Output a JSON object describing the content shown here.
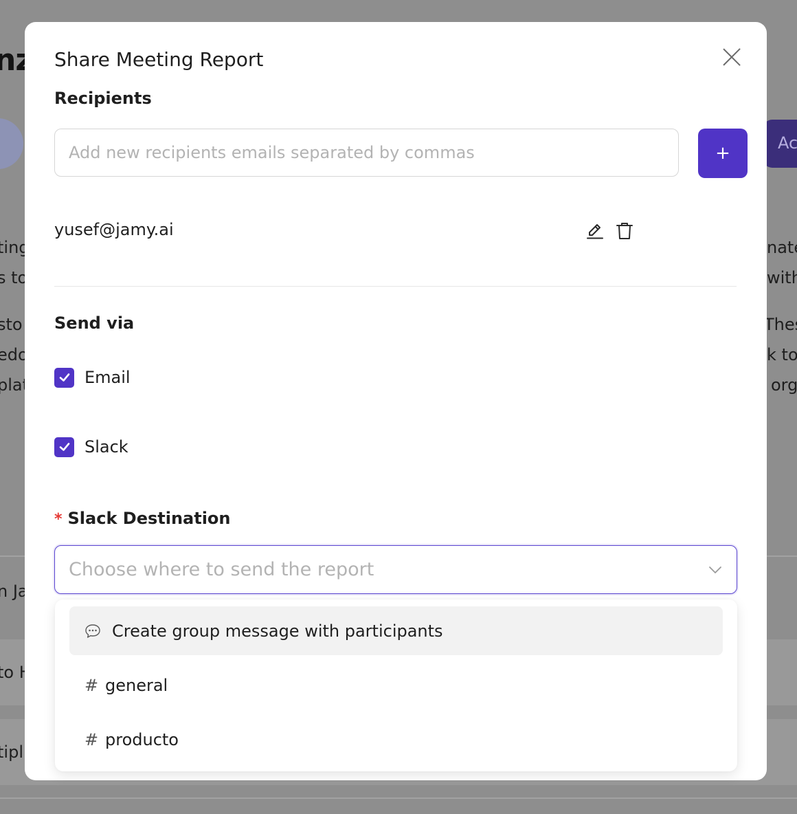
{
  "background": {
    "logo_fragment": "nz",
    "add_button_fragment": "Ac",
    "left_fragments": [
      "ting",
      "s to",
      "sto",
      "edo",
      "plat",
      "n Ja",
      "to H",
      "tipl"
    ],
    "right_fragments": [
      "nate",
      "withi",
      "Thes",
      "k to",
      "org"
    ]
  },
  "modal": {
    "title": "Share Meeting Report",
    "close_icon": "close-icon",
    "recipients": {
      "label": "Recipients",
      "input_placeholder": "Add new recipients emails separated by commas",
      "input_value": "",
      "add_button_label": "+",
      "list": [
        {
          "email": "yusef@jamy.ai",
          "edit_icon": "pencil-icon",
          "delete_icon": "trash-icon"
        }
      ]
    },
    "send_via": {
      "label": "Send via",
      "options": [
        {
          "label": "Email",
          "checked": true
        },
        {
          "label": "Slack",
          "checked": true
        }
      ]
    },
    "slack_destination": {
      "required_mark": "*",
      "label": "Slack Destination",
      "placeholder": "Choose where to send the report",
      "chevron_icon": "chevron-down-icon",
      "options": [
        {
          "label": "Create group message with participants",
          "icon": "chat-bubble-icon",
          "highlighted": true
        },
        {
          "label": "general",
          "icon": "#",
          "highlighted": false
        },
        {
          "label": "producto",
          "icon": "#",
          "highlighted": false
        }
      ]
    }
  },
  "colors": {
    "accent": "#5034c6",
    "overlay": "#8e8e8e",
    "required": "#e53935",
    "highlight": "#f2f2f2"
  }
}
